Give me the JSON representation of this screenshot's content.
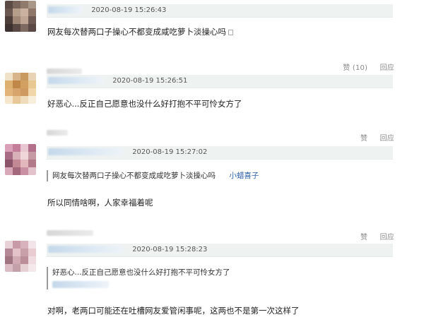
{
  "comments": [
    {
      "time": "2020-08-19 15:26:43",
      "text": "网友每次替两口子操心不都变成咸吃萝卜淡操心吗",
      "actions": []
    },
    {
      "time": "2020-08-19 15:26:51",
      "text": "好恶心...反正自己愿意也没什么好打抱不平可怜女方了",
      "actions": [
        "赞 (10)",
        "回应"
      ]
    },
    {
      "time": "2020-08-19 15:27:02",
      "quote_text": "网友每次替两口子操心不都变成咸吃萝卜淡操心吗",
      "quote_author": "小蜡喜子",
      "text": "所以同情啥啊，人家幸福着呢",
      "actions": [
        "赞",
        "回应"
      ]
    },
    {
      "time": "2020-08-19 15:28:23",
      "quote_text": "好恶心...反正自己愿意也没什么好打抱不平可怜女方了",
      "text": "对啊，老两口可能还在吐槽网友爱管闲事呢，这两也不是第一次这样了",
      "actions": [
        "赞",
        "回应"
      ]
    }
  ],
  "actions_last": [
    "赞",
    "回应"
  ]
}
